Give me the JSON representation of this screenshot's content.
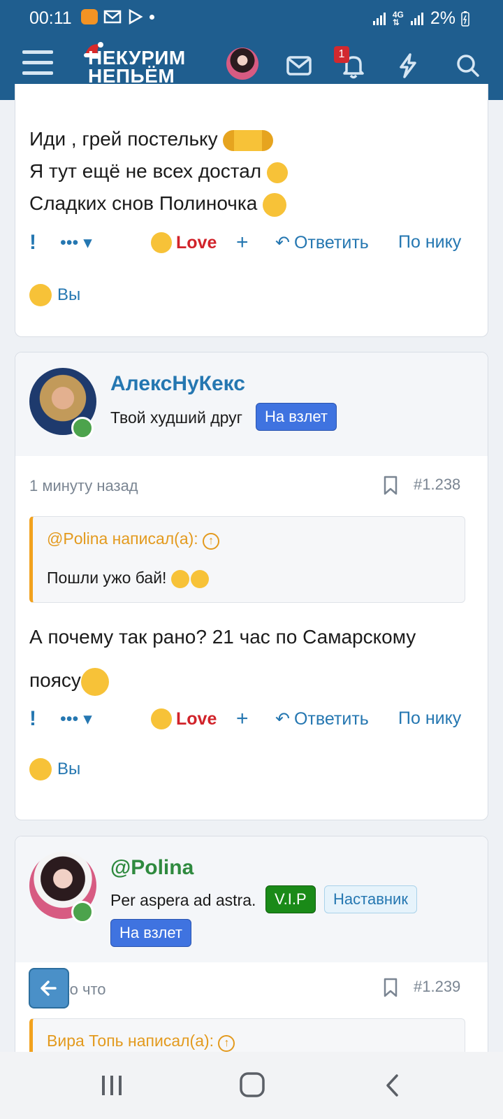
{
  "status": {
    "time": "00:11",
    "battery": "2%"
  },
  "header": {
    "logo_line1": "НЕКУРИМ",
    "logo_line2": "НЕПЬЁМ",
    "notification_count": "1"
  },
  "colors": {
    "header_bg": "#1f5e8f",
    "link": "#2577b1",
    "love": "#d1232a",
    "quote_accent": "#f2a21e",
    "online": "#4ca34c",
    "vip": "#1a8a18",
    "nav_tag": "#3f73e0"
  },
  "post1": {
    "lines": [
      "Иди , грей постельку",
      "Я тут ещё не всех достал",
      "Сладких снов Полиночка"
    ],
    "actions": {
      "love": "Love",
      "plus": "+",
      "reply": "Ответить",
      "by_nick": "По нику"
    },
    "reacted": "Вы"
  },
  "post2": {
    "username": "АлексНуКекс",
    "user_title": "Твой худший друг",
    "tag": "На взлет",
    "time": "1 минуту назад",
    "number": "#1.238",
    "quote_author": "@Polina написал(а):",
    "quote_text": "Пошли ужо бай!",
    "text_line1": "А почему так рано? 21 час по Самарскому",
    "text_line2": "поясу",
    "actions": {
      "love": "Love",
      "plus": "+",
      "reply": "Ответить",
      "by_nick": "По нику"
    },
    "reacted": "Вы"
  },
  "post3": {
    "username": "@Polina",
    "user_title": "Per aspera ad astra.",
    "tags": [
      "V.I.P",
      "Наставник",
      "На взлет"
    ],
    "time": "Только что",
    "number": "#1.239",
    "quote_author": "Вира Топь написал(а):"
  }
}
